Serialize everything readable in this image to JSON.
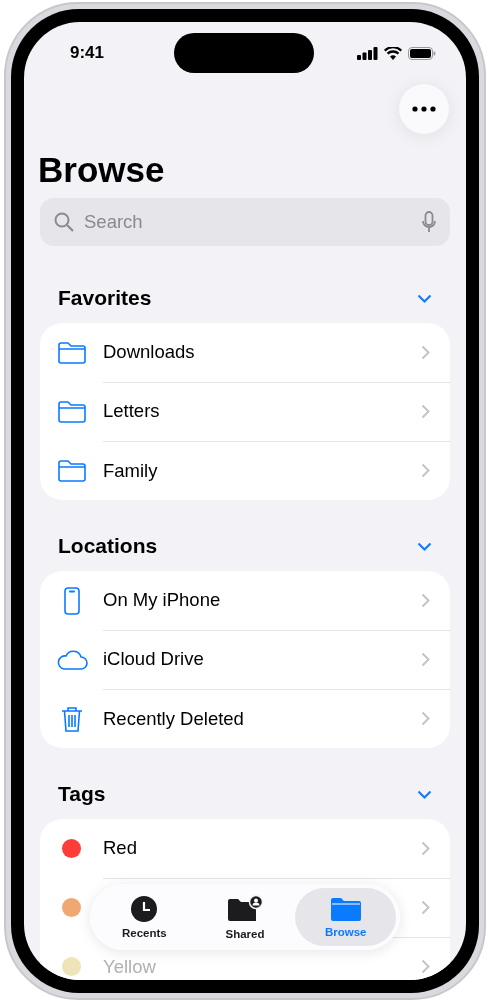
{
  "status_bar": {
    "time": "9:41"
  },
  "title": "Browse",
  "search": {
    "placeholder": "Search"
  },
  "sections": [
    {
      "title": "Favorites",
      "expanded": true,
      "items": [
        {
          "kind": "folder",
          "label": "Downloads"
        },
        {
          "kind": "folder",
          "label": "Letters"
        },
        {
          "kind": "folder",
          "label": "Family"
        }
      ]
    },
    {
      "title": "Locations",
      "expanded": true,
      "items": [
        {
          "kind": "phone",
          "label": "On My iPhone"
        },
        {
          "kind": "cloud",
          "label": "iCloud Drive"
        },
        {
          "kind": "trash",
          "label": "Recently Deleted"
        }
      ]
    },
    {
      "title": "Tags",
      "expanded": true,
      "items": [
        {
          "kind": "tag",
          "label": "Red",
          "color": "#fc3d39"
        },
        {
          "kind": "tag",
          "color": "#f0a873"
        },
        {
          "kind": "tag",
          "label": "Yellow",
          "color": "#efe3b8"
        }
      ]
    }
  ],
  "tab_bar": [
    {
      "kind": "recents",
      "label": "Recents",
      "selected": false
    },
    {
      "kind": "shared",
      "label": "Shared",
      "selected": false
    },
    {
      "kind": "browse",
      "label": "Browse",
      "selected": true
    }
  ]
}
